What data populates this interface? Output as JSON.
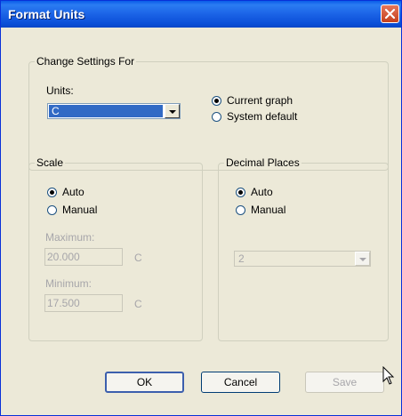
{
  "window": {
    "title": "Format Units"
  },
  "change_settings": {
    "legend": "Change Settings For",
    "units_label": "Units:",
    "units_value": "C",
    "option_current": "Current graph",
    "option_system": "System default"
  },
  "scale": {
    "legend": "Scale",
    "auto": "Auto",
    "manual": "Manual",
    "maximum_label": "Maximum:",
    "maximum_value": "20.000",
    "maximum_unit": "C",
    "minimum_label": "Minimum:",
    "minimum_value": "17.500",
    "minimum_unit": "C"
  },
  "decimal": {
    "legend": "Decimal Places",
    "auto": "Auto",
    "manual": "Manual",
    "places_value": "2"
  },
  "buttons": {
    "ok": "OK",
    "cancel": "Cancel",
    "save": "Save"
  }
}
